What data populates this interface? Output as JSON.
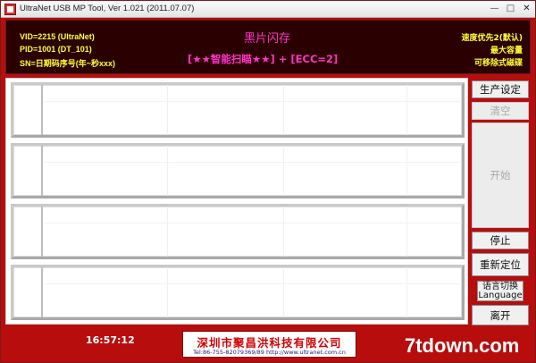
{
  "window": {
    "title": "UltraNet USB MP Tool, Ver 1.021 (2011.07.07)",
    "min_label": "—",
    "max_label": "□",
    "close_label": "✕"
  },
  "header": {
    "vid": "VID=2215 (UltraNet)",
    "pid": "PID=1001 (DT_101)",
    "sn": "SN=日期码序号(年~秒xxx)",
    "mode_title": "黑片闪存",
    "mode_sub": "[★★智能扫瞄★★] + [ECC=2]",
    "opt1": "速度优先2(默认)",
    "opt2": "最大容量",
    "opt3": "可移除式磁碟"
  },
  "ports": [
    {
      "id": 1
    },
    {
      "id": 2
    },
    {
      "id": 3
    },
    {
      "id": 4
    }
  ],
  "buttons": {
    "settings": "生产设定",
    "clear": "清空",
    "start": "开始",
    "stop": "停止",
    "relocate": "重新定位",
    "lang_cn": "语言切换",
    "lang_en": "Language",
    "exit": "离开"
  },
  "footer": {
    "clock": "16:57:12",
    "company": "深圳市聚昌洪科技有限公司",
    "contact": "Tel:86-755-82079369/89   http://www.ultranet.com.cn",
    "watermark": "7tdown.com"
  },
  "colors": {
    "frame": "#b80d0d",
    "header_bg": "#2b0000",
    "header_text": "#ffff3a",
    "accent": "#ff33cc"
  }
}
